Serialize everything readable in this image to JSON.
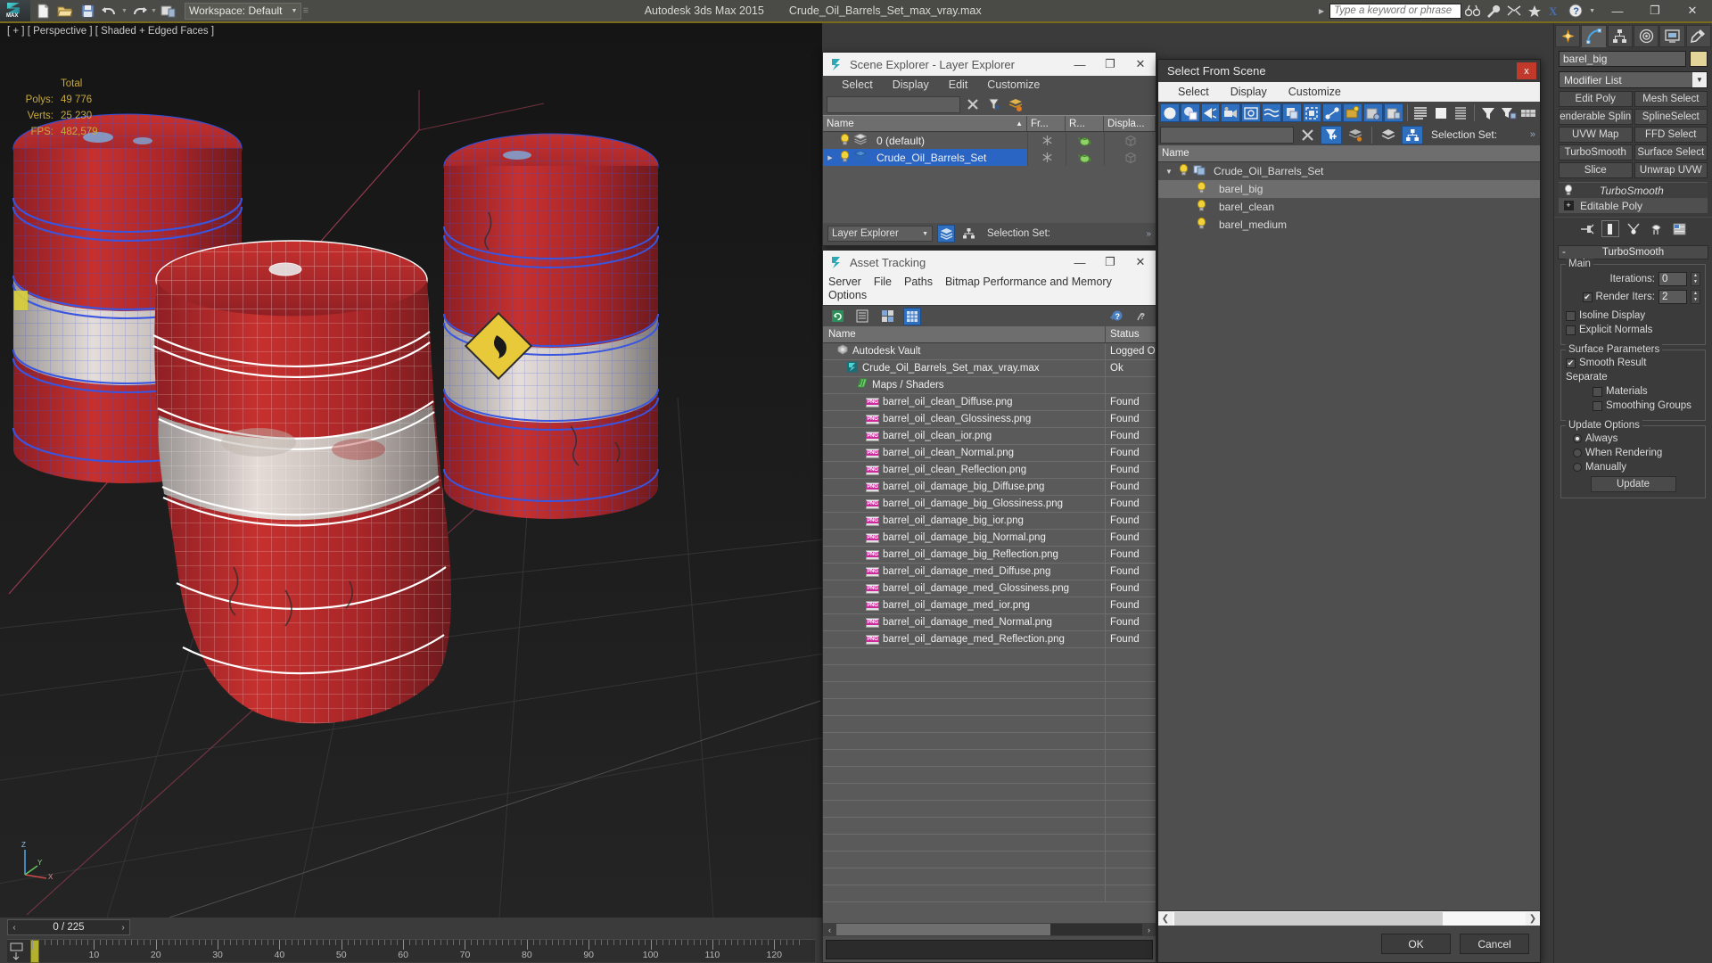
{
  "titlebar": {
    "app_title": "Autodesk 3ds Max  2015",
    "file_name": "Crude_Oil_Barrels_Set_max_vray.max",
    "workspace_label": "Workspace: Default",
    "search_placeholder": "Type a keyword or phrase",
    "quick_access": [
      "new-file-icon",
      "open-file-icon",
      "save-file-icon",
      "undo-icon",
      "redo-icon",
      "set-project-folder-icon"
    ],
    "right_icons": [
      "binoculars-icon",
      "wrench-icon",
      "subscription-icon",
      "star-icon",
      "exchange-icon",
      "help-icon"
    ],
    "window_buttons": {
      "minimize": "—",
      "maximize": "❐",
      "close": "✕"
    }
  },
  "viewport": {
    "label": "[ + ] [ Perspective ] [ Shaded + Edged Faces ]",
    "stats": {
      "total_header": "Total",
      "polys_label": "Polys:",
      "polys_value": "49 776",
      "verts_label": "Verts:",
      "verts_value": "25 230",
      "fps_label": "FPS:",
      "fps_value": "482,579"
    },
    "axis_labels": {
      "z": "Z",
      "y": "Y",
      "x": "X"
    }
  },
  "timeline": {
    "frame_current": "0 / 225",
    "prev_arrow": "‹",
    "next_arrow": "›",
    "ticks": [
      10,
      20,
      30,
      40,
      50,
      60,
      70,
      80,
      90,
      100,
      110,
      120
    ]
  },
  "scene_explorer": {
    "title": "Scene Explorer - Layer Explorer",
    "window_buttons": {
      "minimize": "—",
      "maximize": "❐",
      "close": "✕"
    },
    "menu": [
      "Select",
      "Display",
      "Edit",
      "Customize"
    ],
    "find_value": "",
    "columns": [
      "Name",
      "Fr...",
      "R...",
      "Displa..."
    ],
    "sort_indicator": "▲",
    "rows": [
      {
        "name": "0 (default)",
        "selected": false,
        "expandable": false,
        "frozen_icon": "snowflake-icon",
        "render_icon": "teapot-icon",
        "display_icon": "box-icon"
      },
      {
        "name": "Crude_Oil_Barrels_Set",
        "selected": true,
        "expandable": true,
        "frozen_icon": "snowflake-icon",
        "render_icon": "teapot-icon",
        "display_icon": "box-icon"
      }
    ],
    "footer": {
      "mode": "Layer Explorer",
      "selection_set_label": "Selection Set:",
      "overflow": "»"
    }
  },
  "asset_tracking": {
    "title": "Asset Tracking",
    "window_buttons": {
      "minimize": "—",
      "maximize": "❐",
      "close": "✕"
    },
    "menu": [
      "Server",
      "File",
      "Paths",
      "Bitmap Performance and Memory",
      "Options"
    ],
    "toolbar_icons": [
      "refresh-icon",
      "list-view-icon",
      "details-view-icon",
      "grid-view-icon",
      "help-add-icon",
      "help-icon"
    ],
    "columns": [
      "Name",
      "Status"
    ],
    "rows": [
      {
        "name": "Autodesk Vault",
        "status": "Logged O",
        "icon": "vault-icon",
        "indent": 1
      },
      {
        "name": "Crude_Oil_Barrels_Set_max_vray.max",
        "status": "Ok",
        "icon": "max-file-icon",
        "indent": 2
      },
      {
        "name": "Maps / Shaders",
        "status": "",
        "icon": "maps-icon",
        "indent": 3
      },
      {
        "name": "barrel_oil_clean_Diffuse.png",
        "status": "Found",
        "icon": "png-icon",
        "indent": 4
      },
      {
        "name": "barrel_oil_clean_Glossiness.png",
        "status": "Found",
        "icon": "png-icon",
        "indent": 4
      },
      {
        "name": "barrel_oil_clean_ior.png",
        "status": "Found",
        "icon": "png-icon",
        "indent": 4
      },
      {
        "name": "barrel_oil_clean_Normal.png",
        "status": "Found",
        "icon": "png-icon",
        "indent": 4
      },
      {
        "name": "barrel_oil_clean_Reflection.png",
        "status": "Found",
        "icon": "png-icon",
        "indent": 4
      },
      {
        "name": "barrel_oil_damage_big_Diffuse.png",
        "status": "Found",
        "icon": "png-icon",
        "indent": 4
      },
      {
        "name": "barrel_oil_damage_big_Glossiness.png",
        "status": "Found",
        "icon": "png-icon",
        "indent": 4
      },
      {
        "name": "barrel_oil_damage_big_ior.png",
        "status": "Found",
        "icon": "png-icon",
        "indent": 4
      },
      {
        "name": "barrel_oil_damage_big_Normal.png",
        "status": "Found",
        "icon": "png-icon",
        "indent": 4
      },
      {
        "name": "barrel_oil_damage_big_Reflection.png",
        "status": "Found",
        "icon": "png-icon",
        "indent": 4
      },
      {
        "name": "barrel_oil_damage_med_Diffuse.png",
        "status": "Found",
        "icon": "png-icon",
        "indent": 4
      },
      {
        "name": "barrel_oil_damage_med_Glossiness.png",
        "status": "Found",
        "icon": "png-icon",
        "indent": 4
      },
      {
        "name": "barrel_oil_damage_med_ior.png",
        "status": "Found",
        "icon": "png-icon",
        "indent": 4
      },
      {
        "name": "barrel_oil_damage_med_Normal.png",
        "status": "Found",
        "icon": "png-icon",
        "indent": 4
      },
      {
        "name": "barrel_oil_damage_med_Reflection.png",
        "status": "Found",
        "icon": "png-icon",
        "indent": 4
      }
    ],
    "scroll": {
      "left_arrow": "‹",
      "right_arrow": "›"
    }
  },
  "select_from_scene": {
    "title": "Select From Scene",
    "close_label": "x",
    "menu": [
      "Select",
      "Display",
      "Customize"
    ],
    "filter_buttons": [
      "geometry-filter-icon",
      "shapes-filter-icon",
      "lights-filter-icon",
      "cameras-filter-icon",
      "helpers-filter-icon",
      "space-warps-filter-icon",
      "groups-filter-icon",
      "xrefs-filter-icon",
      "bones-filter-icon",
      "containers-filter-icon",
      "materials-filter-icon",
      "plugins-filter-icon"
    ],
    "view_buttons": [
      "expand-all-icon",
      "collapse-all-icon",
      "list-view-icon"
    ],
    "sort_buttons": [
      "filter-icon",
      "filter-settings-icon",
      "columns-icon"
    ],
    "find_value": "",
    "toolbar2_icons": [
      "clear-find-icon",
      "select-filter-icon",
      "layers-icon",
      "layer-stack-icon",
      "hierarchy-icon"
    ],
    "selection_set_label": "Selection Set:",
    "overflow": "»",
    "column_header": "Name",
    "tree": [
      {
        "name": "Crude_Oil_Barrels_Set",
        "level": 0,
        "selected": false,
        "expander": "▼",
        "icon": "group-icon"
      },
      {
        "name": "barel_big",
        "level": 1,
        "selected": true,
        "expander": "",
        "icon": "object-sphere-icon"
      },
      {
        "name": "barel_clean",
        "level": 1,
        "selected": false,
        "expander": "",
        "icon": "object-sphere-icon"
      },
      {
        "name": "barel_medium",
        "level": 1,
        "selected": false,
        "expander": "",
        "icon": "object-sphere-icon"
      }
    ],
    "buttons": {
      "ok": "OK",
      "cancel": "Cancel"
    },
    "scroll": {
      "left_arrow": "❮",
      "right_arrow": "❯"
    }
  },
  "command_panel": {
    "tabs": [
      "create-tab-icon",
      "modify-tab-icon",
      "hierarchy-tab-icon",
      "motion-tab-icon",
      "display-tab-icon",
      "utilities-tab-icon"
    ],
    "active_tab_index": 1,
    "object_name": "barel_big",
    "object_color": "#e3d49a",
    "modifier_list_label": "Modifier List",
    "modifier_buttons": [
      "Edit Poly",
      "Mesh Select",
      "enderable Splin",
      "SplineSelect",
      "UVW Map",
      "FFD Select",
      "TurboSmooth",
      "Surface Select",
      "Slice",
      "Unwrap UVW"
    ],
    "stack": [
      {
        "name": "TurboSmooth",
        "italic": true,
        "current": false,
        "icon": "lightbulb-icon",
        "expander": ""
      },
      {
        "name": "Editable Poly",
        "italic": false,
        "current": true,
        "icon": "",
        "expander": "+"
      }
    ],
    "stack_tools": [
      "pin-stack-icon",
      "show-end-result-icon",
      "make-unique-icon",
      "remove-modifier-icon",
      "configure-sets-icon"
    ],
    "rollout": {
      "header": "TurboSmooth",
      "collapse_glyph": "-",
      "main": {
        "label": "Main",
        "iterations_label": "Iterations:",
        "iterations_value": "0",
        "render_iters_label": "Render Iters:",
        "render_iters_value": "2",
        "render_iters_checked": true,
        "isoline_display_label": "Isoline Display",
        "isoline_display_checked": false,
        "explicit_normals_label": "Explicit Normals",
        "explicit_normals_checked": false
      },
      "surface": {
        "label": "Surface Parameters",
        "smooth_result_label": "Smooth Result",
        "smooth_result_checked": true,
        "separate_label": "Separate",
        "materials_label": "Materials",
        "materials_checked": false,
        "smoothing_groups_label": "Smoothing Groups",
        "smoothing_groups_checked": false
      },
      "update": {
        "label": "Update Options",
        "options": [
          "Always",
          "When Rendering",
          "Manually"
        ],
        "selected_index": 0,
        "update_button": "Update"
      }
    }
  },
  "colors": {
    "accent_blue": "#2a65c4",
    "toolbar_blue": "#2f6fbf",
    "barrel_red": "#b8272d",
    "wire_blue": "#2f4fd8",
    "wire_white": "#ffffff",
    "stats_gold": "#c8a83c",
    "panel_bg": "#3b3b3b",
    "close_red": "#c0392b"
  }
}
